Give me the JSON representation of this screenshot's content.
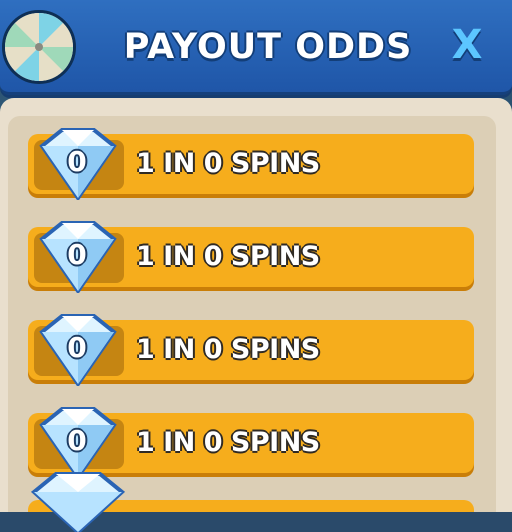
{
  "header": {
    "title": "PAYOUT ODDS",
    "close_label": "X"
  },
  "rows": [
    {
      "gem_count": "0",
      "odds_text": "1 IN 0 SPINS"
    },
    {
      "gem_count": "0",
      "odds_text": "1 IN 0 SPINS"
    },
    {
      "gem_count": "0",
      "odds_text": "1 IN 0 SPINS"
    },
    {
      "gem_count": "0",
      "odds_text": "1 IN 0 SPINS"
    }
  ],
  "colors": {
    "header_blue": "#1f56a8",
    "row_orange": "#f6ad1c",
    "panel_beige": "#e9dfcd",
    "close_blue": "#5cc6ff"
  },
  "icons": {
    "wheel": "prize-wheel-icon",
    "gem": "diamond-gem-icon"
  }
}
